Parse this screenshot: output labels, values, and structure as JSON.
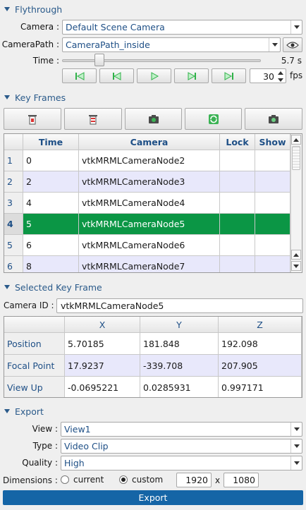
{
  "colors": {
    "accent": "#2a5a8a",
    "selected_row": "#0b9645",
    "export_button": "#1565a6",
    "alt_row": "#e8e8fb"
  },
  "flythrough": {
    "header": "Flythrough",
    "camera_label": "Camera :",
    "camera_value": "Default Scene Camera",
    "camerapath_label": "CameraPath :",
    "camerapath_value": "CameraPath_inside",
    "visibility_icon": "eye-icon",
    "time_label": "Time :",
    "time_value": "5.7 s",
    "time_slider_fraction": 0.17,
    "fps_value": "30",
    "fps_label": "fps",
    "playback_icons": [
      "skip-to-start-icon",
      "step-back-icon",
      "play-icon",
      "step-forward-icon",
      "skip-to-end-icon"
    ]
  },
  "keyframes": {
    "header": "Key Frames",
    "toolbar_icons": [
      "delete-keyframe-icon",
      "delete-all-keyframes-icon",
      "add-keyframe-camera-icon",
      "update-keyframe-icon",
      "snapshot-camera-icon"
    ],
    "columns": [
      "Time",
      "Camera",
      "Lock",
      "Show"
    ],
    "rows": [
      {
        "n": "1",
        "time": "0",
        "camera": "vtkMRMLCameraNode2"
      },
      {
        "n": "2",
        "time": "2",
        "camera": "vtkMRMLCameraNode3"
      },
      {
        "n": "3",
        "time": "4",
        "camera": "vtkMRMLCameraNode4"
      },
      {
        "n": "4",
        "time": "5",
        "camera": "vtkMRMLCameraNode5"
      },
      {
        "n": "5",
        "time": "6",
        "camera": "vtkMRMLCameraNode6"
      },
      {
        "n": "6",
        "time": "8",
        "camera": "vtkMRMLCameraNode7"
      }
    ]
  },
  "selected": {
    "header": "Selected Key Frame",
    "camera_id_label": "Camera ID :",
    "camera_id_value": "vtkMRMLCameraNode5",
    "columns": [
      "X",
      "Y",
      "Z"
    ],
    "rows": [
      {
        "label": "Position",
        "x": "5.70185",
        "y": "181.848",
        "z": "192.098"
      },
      {
        "label": "Focal Point",
        "x": "17.9237",
        "y": "-339.708",
        "z": "207.905"
      },
      {
        "label": "View Up",
        "x": "-0.0695221",
        "y": "0.0285931",
        "z": "0.997171"
      }
    ]
  },
  "export": {
    "header": "Export",
    "view_label": "View :",
    "view_value": "View1",
    "type_label": "Type :",
    "type_value": "Video Clip",
    "quality_label": "Quality :",
    "quality_value": "High",
    "dimensions_label": "Dimensions :",
    "current_label": "current",
    "custom_label": "custom",
    "width": "1920",
    "x_sep": "x",
    "height": "1080",
    "button_label": "Export"
  }
}
